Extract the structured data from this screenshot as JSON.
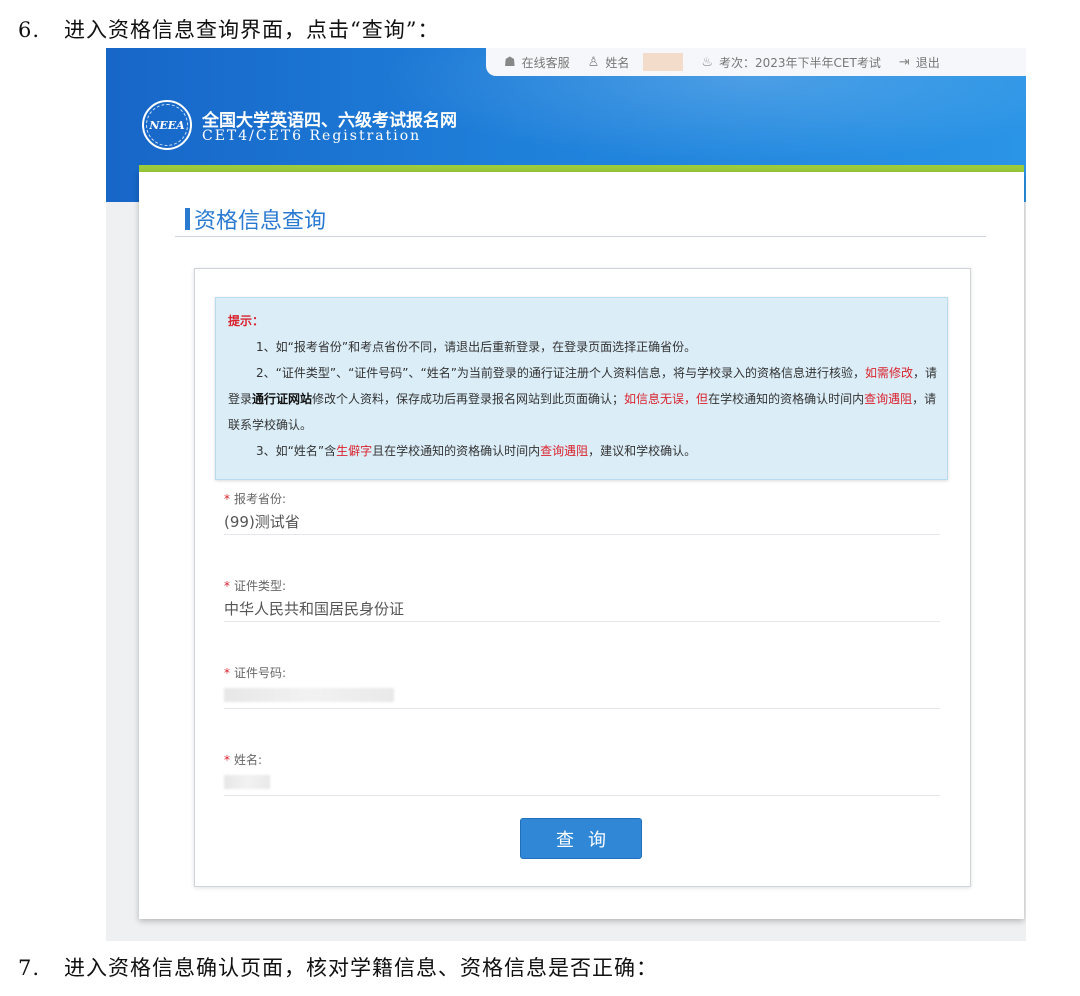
{
  "doc": {
    "line6_num": "6.",
    "line6_text": "进入资格信息查询界面，点击“查询”：",
    "line7_num": "7.",
    "line7_text": "进入资格信息确认页面，核对学籍信息、资格信息是否正确："
  },
  "topbar": {
    "service": "在线客服",
    "name_label": "姓名",
    "exam": "考次：2023年下半年CET考试",
    "logout": "退出"
  },
  "site": {
    "logo_text": "NEEA",
    "title": "全国大学英语四、六级考试报名网",
    "subtitle": "CET4/CET6  Registration"
  },
  "page": {
    "title": "资格信息查询"
  },
  "notice": {
    "heading": "提示：",
    "item1": "1、如“报考省份”和考点省份不同，请退出后重新登录，在登录页面选择正确省份。",
    "item2_a": "2、“证件类型”、“证件号码”、“姓名”为当前登录的通行证注册个人资料信息，将与学校录入的资格信息进行核验，",
    "item2_red1": "如需修改",
    "item2_b": "，请登录",
    "item2_bold": "通行证网站",
    "item2_c": "修改个人资料，保存成功后再登录报名网站到此页面确认；",
    "item2_red2": "如信息无误，但",
    "item2_d": "在学校通知的资格确认时间内",
    "item2_red3": "查询遇阻",
    "item2_e": "，请联系学校确认。",
    "item3_a": "3、如“姓名”含",
    "item3_red1": "生僻字",
    "item3_b": "且在学校通知的资格确认时间内",
    "item3_red2": "查询遇阻",
    "item3_c": "，建议和学校确认。"
  },
  "form": {
    "required_mark": "*",
    "province_label": "报考省份:",
    "province_value": "(99)测试省",
    "idtype_label": "证件类型:",
    "idtype_value": "中华人民共和国居民身份证",
    "idnum_label": "证件号码:",
    "name_label": "姓名:",
    "query_button": "查询"
  }
}
